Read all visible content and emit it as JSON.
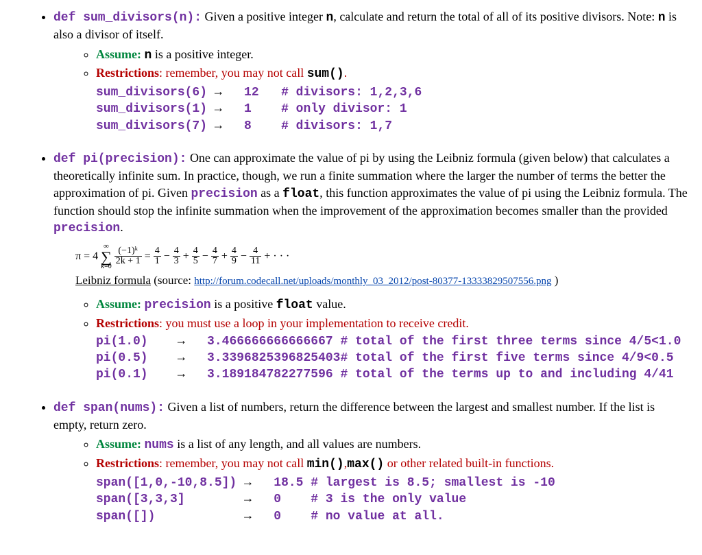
{
  "sum_divisors": {
    "sig": "def sum_divisors(n):",
    "desc_a": " Given a positive integer ",
    "code_n": "n",
    "desc_b": ", calculate and return the total of all of its positive divisors. Note: ",
    "desc_c": " is also a divisor of itself.",
    "assume_label": "Assume:",
    "assume_text_a": " ",
    "assume_code": "n",
    "assume_text_b": " is a positive integer.",
    "restrict_label": "Restrictions",
    "restrict_text": ": remember, you may not call ",
    "restrict_code": "sum()",
    "restrict_end": ".",
    "ex": [
      {
        "call": "sum_divisors(6) ",
        "arrow": "→   ",
        "val": "12   ",
        "comment": "# divisors: 1,2,3,6"
      },
      {
        "call": "sum_divisors(1) ",
        "arrow": "→   ",
        "val": "1    ",
        "comment": "# only divisor: 1"
      },
      {
        "call": "sum_divisors(7) ",
        "arrow": "→   ",
        "val": "8    ",
        "comment": "# divisors: 1,7"
      }
    ]
  },
  "pi": {
    "sig": "def pi(precision):",
    "desc_a": " One can approximate the value of pi by using the Leibniz formula (given below) that calculates a theoretically infinite sum. In practice, though, we run a finite summation where the larger the number of terms the better the approximation of pi. Given ",
    "code_prec": "precision",
    "desc_b": " as a ",
    "code_float": "float",
    "desc_c": ", this function approximates the value of pi using the Leibniz formula. The function should stop the infinite summation when the improvement of the approximation becomes smaller than the provided ",
    "desc_d": ".",
    "formula": {
      "lhs": "π = 4",
      "sum_top": "∞",
      "sum_bot": "k=0",
      "frac_top": "(−1)ᵏ",
      "frac_bot": "2k + 1",
      "eq": " = ",
      "terms": [
        {
          "num": "4",
          "den": "1",
          "op": ""
        },
        {
          "num": "4",
          "den": "3",
          "op": " − "
        },
        {
          "num": "4",
          "den": "5",
          "op": " + "
        },
        {
          "num": "4",
          "den": "7",
          "op": " − "
        },
        {
          "num": "4",
          "den": "9",
          "op": " + "
        },
        {
          "num": "4",
          "den": "11",
          "op": " − "
        }
      ],
      "tail": " + · · ·"
    },
    "caption_a": "Leibniz formula",
    "caption_b": " (source: ",
    "caption_link": "http://forum.codecall.net/uploads/monthly_03_2012/post-80377-13333829507556.png",
    "caption_c": " )",
    "assume_label": "Assume:",
    "assume_text_a": " ",
    "assume_code1": "precision",
    "assume_text_b": " is a positive ",
    "assume_code2": "float",
    "assume_text_c": " value.",
    "restrict_label": "Restrictions",
    "restrict_text": ": you must use a loop in your implementation to receive credit.",
    "ex": [
      {
        "call": "pi(1.0)    ",
        "arrow": "→   ",
        "val": "3.466666666666667 ",
        "comment": "# total of the first three terms since 4/5<1.0"
      },
      {
        "call": "pi(0.5)    ",
        "arrow": "→   ",
        "val": "3.3396825396825403",
        "comment": "# total of the first five terms since 4/9<0.5"
      },
      {
        "call": "pi(0.1)    ",
        "arrow": "→   ",
        "val": "3.189184782277596 ",
        "comment": "# total of the terms up to and including 4/41"
      }
    ]
  },
  "span": {
    "sig": "def span(nums):",
    "desc_a": " Given a list of numbers, return the difference between the largest and smallest number. If the list is empty, return zero.",
    "assume_label": "Assume:",
    "assume_text_a": " ",
    "assume_code": "nums",
    "assume_text_b": " is a list of any length, and all values are numbers.",
    "restrict_label": "Restrictions",
    "restrict_text_a": ": remember, you may not call ",
    "restrict_code1": "min()",
    "restrict_comma": ",",
    "restrict_code2": "max()",
    "restrict_text_b": " or other related built-in functions.",
    "ex": [
      {
        "call": "span([1,0,-10,8.5]) ",
        "arrow": "→   ",
        "val": "18.5 ",
        "comment": "# largest is 8.5; smallest is -10"
      },
      {
        "call": "span([3,3,3]        ",
        "arrow": "→   ",
        "val": "0    ",
        "comment": "# 3 is the only value"
      },
      {
        "call": "span([])            ",
        "arrow": "→   ",
        "val": "0    ",
        "comment": "# no value at all."
      }
    ]
  }
}
